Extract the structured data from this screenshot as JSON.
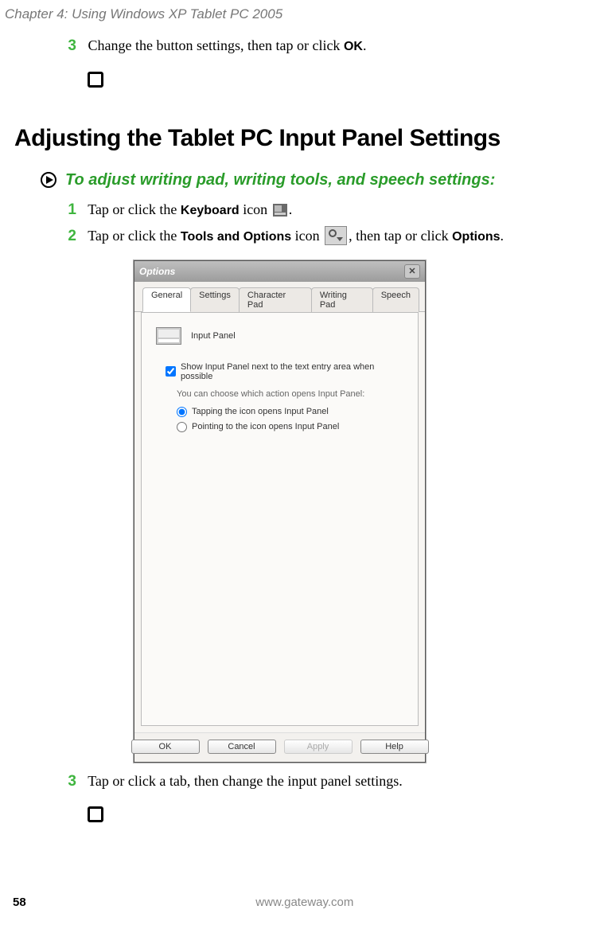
{
  "chapter_header": "Chapter 4: Using Windows XP Tablet PC 2005",
  "top_step": {
    "num": "3",
    "text_before": "Change the button settings, then tap or click ",
    "bold": "OK",
    "text_after": "."
  },
  "section_heading": "Adjusting the Tablet PC Input Panel Settings",
  "sub_heading": "To adjust writing pad, writing tools, and speech settings:",
  "step1": {
    "num": "1",
    "before": "Tap or click the ",
    "bold": "Keyboard",
    "after": " icon ",
    "tail": "."
  },
  "step2": {
    "num": "2",
    "before": "Tap or click the ",
    "bold1": "Tools and Options",
    "mid": " icon ",
    "after": ", then tap or click ",
    "bold2": "Options",
    "tail": "."
  },
  "dialog": {
    "title": "Options",
    "tabs": [
      "General",
      "Settings",
      "Character Pad",
      "Writing Pad",
      "Speech"
    ],
    "panel_title": "Input Panel",
    "checkbox_label": "Show Input Panel next to the text entry area when possible",
    "desc": "You can choose which action opens Input Panel:",
    "radio1": "Tapping the icon opens Input Panel",
    "radio2": "Pointing to the icon opens Input Panel",
    "buttons": {
      "ok": "OK",
      "cancel": "Cancel",
      "apply": "Apply",
      "help": "Help"
    }
  },
  "step3": {
    "num": "3",
    "text": "Tap or click a tab, then change the input panel settings."
  },
  "footer": {
    "page": "58",
    "url": "www.gateway.com"
  }
}
